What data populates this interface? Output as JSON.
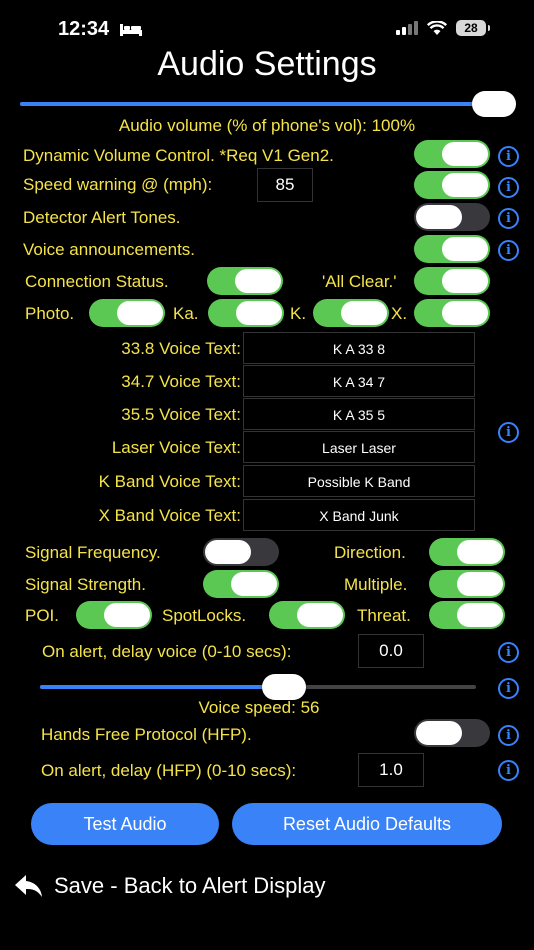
{
  "status": {
    "time": "12:34",
    "battery": "28"
  },
  "title": "Audio Settings",
  "volume": {
    "label": "Audio volume (% of phone's vol): 100%",
    "level_pct": 100
  },
  "dynamic_volume": {
    "label": "Dynamic Volume Control. *Req V1 Gen2.",
    "on": true
  },
  "speed_warning": {
    "label": "Speed warning @ (mph):",
    "value": "85",
    "on": true
  },
  "detector_tones": {
    "label": "Detector Alert Tones.",
    "on": false
  },
  "voice_announcements": {
    "label": "Voice announcements.",
    "on": true
  },
  "connection_status": {
    "label": "Connection Status.",
    "on": true
  },
  "all_clear": {
    "label": "'All Clear.'",
    "on": true
  },
  "bands": {
    "photo": {
      "label": "Photo.",
      "on": true
    },
    "ka": {
      "label": "Ka.",
      "on": true
    },
    "k": {
      "label": "K.",
      "on": true
    },
    "x": {
      "label": "X.",
      "on": true
    }
  },
  "voice_texts": [
    {
      "label": "33.8 Voice Text:",
      "value": "K A 33 8"
    },
    {
      "label": "34.7 Voice Text:",
      "value": "K A 34 7"
    },
    {
      "label": "35.5 Voice Text:",
      "value": "K A 35 5"
    },
    {
      "label": "Laser Voice Text:",
      "value": "Laser Laser"
    },
    {
      "label": "K Band Voice Text:",
      "value": "Possible K Band"
    },
    {
      "label": "X Band Voice Text:",
      "value": "X Band Junk"
    }
  ],
  "signal_frequency": {
    "label": "Signal Frequency.",
    "on": false
  },
  "direction": {
    "label": "Direction.",
    "on": true
  },
  "signal_strength": {
    "label": "Signal Strength.",
    "on": true
  },
  "multiple": {
    "label": "Multiple.",
    "on": true
  },
  "poi": {
    "label": "POI.",
    "on": true
  },
  "spotlocks": {
    "label": "SpotLocks.",
    "on": true
  },
  "threat": {
    "label": "Threat.",
    "on": true
  },
  "delay_voice": {
    "label": "On alert, delay voice (0-10 secs):",
    "value": "0.0"
  },
  "voice_speed": {
    "label": "Voice speed: 56",
    "value": 56
  },
  "hfp": {
    "label": "Hands Free Protocol (HFP).",
    "on": false
  },
  "delay_hfp": {
    "label": "On alert, delay (HFP) (0-10 secs):",
    "value": "1.0"
  },
  "buttons": {
    "test": "Test Audio",
    "reset": "Reset Audio Defaults"
  },
  "back": {
    "label": "Save - Back to Alert Display"
  }
}
